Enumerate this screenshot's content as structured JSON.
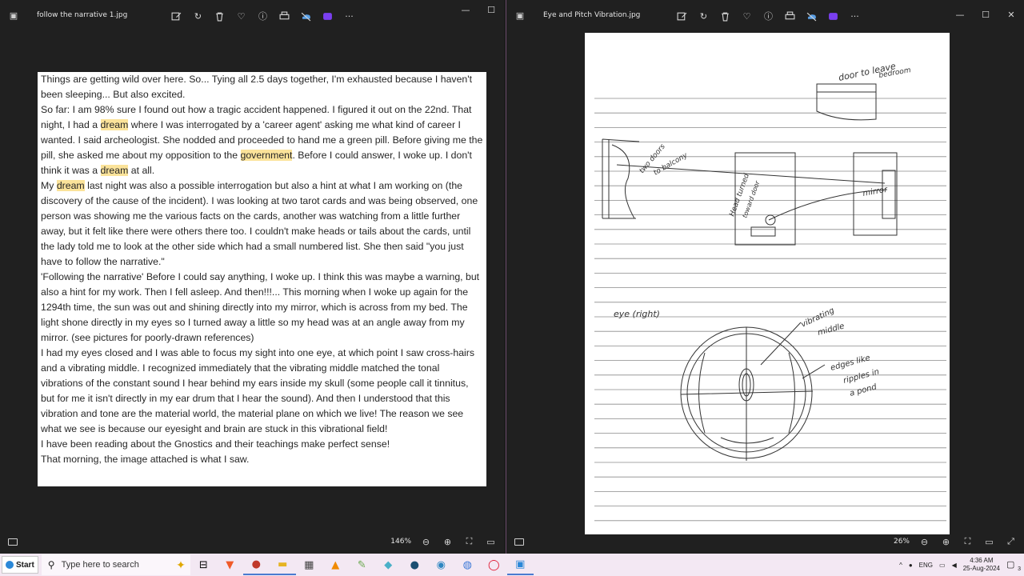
{
  "left_window": {
    "title": "follow the narrative 1.jpg",
    "zoom": "146%",
    "toolbar_icons": [
      "edit-icon",
      "rotate-icon",
      "delete-icon",
      "favorite-icon",
      "info-icon",
      "print-icon",
      "onedrive-icon",
      "clipchamp-icon",
      "more-icon"
    ],
    "paragraphs": [
      [
        {
          "t": "Things are getting wild over here. So... Tying all 2.5 days together, I'm exhausted because I haven't been sleeping... But also excited."
        }
      ],
      [
        {
          "t": "So far: I am 98% sure I found out how a tragic accident happened. I figured it out on the 22nd. That night, I had a "
        },
        {
          "t": "dream",
          "h": true
        },
        {
          "t": " where I was interrogated by a 'career agent' asking me what kind of career I wanted. I said archeologist. She nodded and proceeded to hand me a green pill. Before giving me the pill, she asked me about my opposition to the "
        },
        {
          "t": "government",
          "h": true
        },
        {
          "t": ". Before I could answer, I woke up. I don't think it was a "
        },
        {
          "t": "dream",
          "h": true
        },
        {
          "t": " at all."
        }
      ],
      [
        {
          "t": "My "
        },
        {
          "t": "dream",
          "h": true
        },
        {
          "t": " last night was also a possible interrogation but also a hint at what I am working on (the discovery of the cause of the incident). I was looking at two tarot cards and was being observed, one person was showing me the various facts on the cards, another was watching from a little further away, but it felt like there were others there too. I couldn't make heads or tails about the cards, until the lady told me to look at the other side which had a small numbered list. She then said \"you just have to follow the narrative.\""
        }
      ],
      [
        {
          "t": "'Following the narrative'  Before I could say anything, I woke up. I think this was maybe a warning, but also a hint for my work. Then I fell asleep. And then!!!... This morning when I woke up again for the 1294th time, the sun was out and shining directly into my mirror, which is across from my bed. The light shone directly in my eyes so I turned away a little so my head was at an angle away from my mirror. (see pictures for poorly-drawn references)"
        }
      ],
      [
        {
          "t": "I had my eyes closed and I was able to focus my sight into one eye, at which point I saw cross-hairs and a vibrating middle. I recognized immediately that the vibrating middle matched the tonal vibrations of the constant sound I hear behind my ears inside my skull (some people call it tinnitus, but for me it isn't directly in my ear drum that I hear the sound). And then I understood that this vibration and tone are the material world, the material plane on which we live! The reason we see what we see is because our eyesight and brain are stuck in this vibrational field!"
        }
      ],
      [
        {
          "t": "I have been reading about the Gnostics and their teachings make perfect sense!"
        }
      ],
      [
        {
          "t": " "
        }
      ],
      [
        {
          "t": "That morning, the image attached is what I saw."
        }
      ]
    ]
  },
  "right_window": {
    "title": "Eye and Pitch Vibration.jpg",
    "zoom": "26%",
    "sketch_labels": {
      "door": "door to leave",
      "bedroom": "bedroom",
      "two_doors": "two doors",
      "balcony": "to balcony",
      "head_turned": "Head turned",
      "toward_door": "toward door",
      "mirror": "mirror",
      "eye": "eye  (right)",
      "vibrating": "vibrating",
      "middle": "middle",
      "edges": "edges like",
      "ripples": "ripples in",
      "pond": "a pond"
    }
  },
  "taskbar": {
    "start_label": "Start",
    "search_placeholder": "Type here to search",
    "language": "ENG",
    "time": "4:36 AM",
    "date": "25-Aug-2024",
    "notification_count": "3",
    "apps": [
      "task-view-icon",
      "brave-icon",
      "app-icon",
      "file-explorer-icon",
      "calculator-icon",
      "vlc-icon",
      "paint-icon",
      "app-icon-2",
      "steam-icon",
      "app-icon-3",
      "app-icon-4",
      "opera-icon",
      "photos-icon"
    ]
  }
}
